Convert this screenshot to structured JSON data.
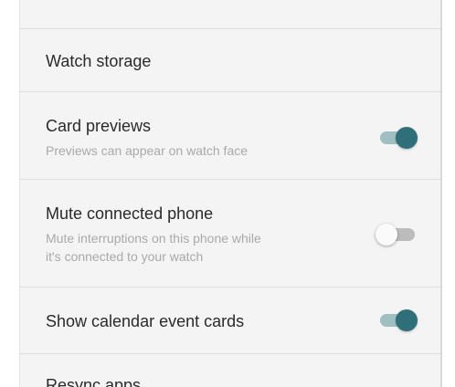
{
  "settings": {
    "watch_storage": {
      "title": "Watch storage"
    },
    "card_previews": {
      "title": "Card previews",
      "subtitle": "Previews can appear on watch face",
      "enabled": true
    },
    "mute_connected_phone": {
      "title": "Mute connected phone",
      "subtitle_line1": "Mute interruptions on this phone while",
      "subtitle_line2": "it's connected to your watch",
      "enabled": false
    },
    "show_calendar_event_cards": {
      "title": "Show calendar event cards",
      "enabled": true
    },
    "resync_apps": {
      "title": "Resync apps"
    }
  },
  "colors": {
    "toggle_on_thumb": "#2f6f7a",
    "toggle_on_track": "#9fbfc3",
    "toggle_off_track": "#bcbcbc",
    "panel_background": "#f4f4f4",
    "title_text": "#2a2a2a",
    "subtitle_text": "#a9a9a9"
  }
}
